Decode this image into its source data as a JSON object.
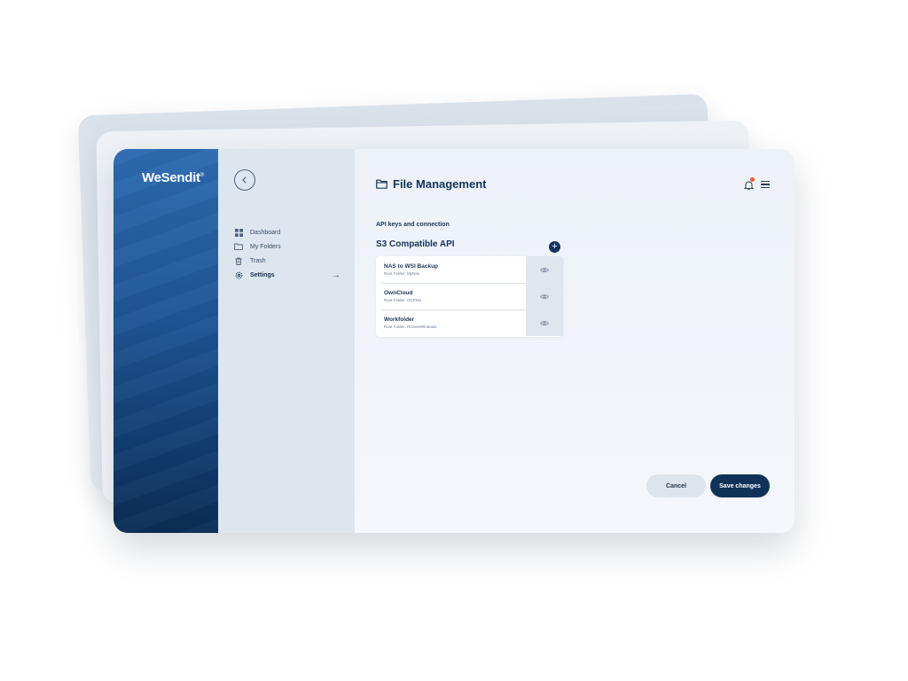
{
  "app": {
    "logo": "WeSendit",
    "logo_mark": "®"
  },
  "nav": {
    "items": [
      {
        "label": "Dashboard",
        "icon": "grid-icon",
        "active": false
      },
      {
        "label": "My Folders",
        "icon": "folder-icon",
        "active": false
      },
      {
        "label": "Trash",
        "icon": "trash-icon",
        "active": false
      },
      {
        "label": "Settings",
        "icon": "gear-icon",
        "active": true
      }
    ]
  },
  "header": {
    "title": "File Management",
    "notification_dot_color": "#f05a28"
  },
  "section": {
    "label": "API keys and connection",
    "api_title": "S3 Compatible API"
  },
  "api_keys": [
    {
      "name": "NAS to WSI Backup",
      "root": "Root Folder: MyNas"
    },
    {
      "name": "OwnCloud",
      "root": "Root Folder: OCFiles"
    },
    {
      "name": "Workfolder",
      "root": "Root Folder: RCloneWindows"
    }
  ],
  "actions": {
    "cancel": "Cancel",
    "save": "Save changes"
  },
  "colors": {
    "brand_dark": "#103259",
    "accent": "#f05a28"
  }
}
